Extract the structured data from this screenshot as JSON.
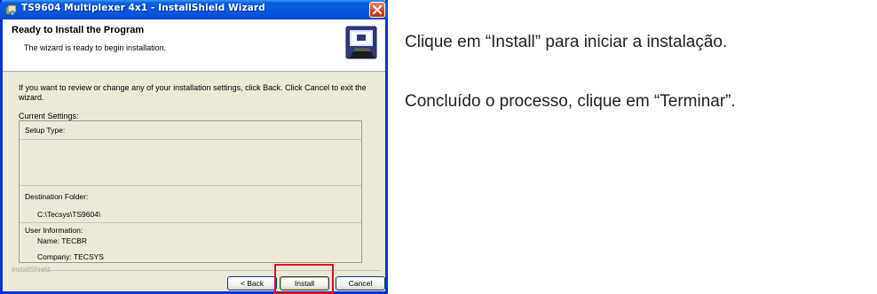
{
  "window": {
    "title": "TS9604 Multiplexer 4x1 - InstallShield Wizard",
    "header_title": "Ready to Install the Program",
    "header_subtitle": "The wizard is ready to begin installation.",
    "body_text": "If you want to review or change any of your installation settings, click Back. Click Cancel to exit the wizard.",
    "current_settings_label": "Current Settings:",
    "settings": {
      "setup_type_label": "Setup Type:",
      "destination_folder_label": "Destination Folder:",
      "destination_folder_value": "C:\\Tecsys\\TS9604\\",
      "user_information_label": "User Information:",
      "name_line": "Name: TECBR",
      "company_line": "Company: TECSYS"
    },
    "brand_watermark": "InstallShield",
    "buttons": {
      "back": "< Back",
      "install": "Install",
      "cancel": "Cancel"
    }
  },
  "instructions": {
    "line1": "Clique em “Install” para iniciar a instalação.",
    "line2": "Concluído o processo, clique em “Terminar”."
  },
  "colors": {
    "titlebar_blue": "#0358dd",
    "highlight_red": "#e30b1b",
    "dialog_bg": "#ece9d8"
  },
  "icons": {
    "app": "installer-icon",
    "close": "close-icon",
    "header": "computer-install-icon"
  }
}
